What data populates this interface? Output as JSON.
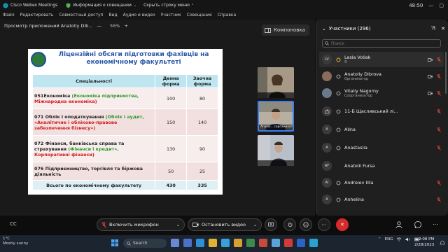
{
  "window": {
    "app_title": "Cisco Webex Meetings",
    "meeting_info": "Информация о совещании",
    "hide_menu": "Скрыть строку меню",
    "timer": "48:50"
  },
  "menu": [
    "Файл",
    "Редактировать",
    "Совместный доступ",
    "Вид",
    "Аудио и видео",
    "Участник",
    "Совещание",
    "Справка"
  ],
  "share": {
    "label": "Просмотр приложений Anatoliy Dib...",
    "minus": "—",
    "zoom": "56%",
    "plus": "+"
  },
  "layout_button": "Компоновка",
  "slide": {
    "title": "Ліцензійні обсяги підготовки фахівців на економічному факультеті",
    "headers": [
      "Спеціальності",
      "Денна форма",
      "Заочна форма"
    ],
    "rows": [
      {
        "name_prefix": "051Економіка ",
        "name_green": "(Економіка підприємства, ",
        "name_red": "Міжнародна економіка)",
        "day": "100",
        "extra": "80"
      },
      {
        "name_prefix": "071 Облік і оподаткування ",
        "name_green": "(Облік і аудит, ",
        "name_red": "«Аналітичне і обліково-правове забезпечення бізнесу»)",
        "day": "150",
        "extra": "140"
      },
      {
        "name_prefix": "072 Фінанси, банківська справа та страхування ",
        "name_green": "(Фінанси і кредит», ",
        "name_red": "Корпоративні фінанси)",
        "day": "130",
        "extra": "90"
      },
      {
        "name_prefix": "076 Підприємництво, торгівля та біржова діяльність",
        "name_green": "",
        "name_red": "",
        "day": "50",
        "extra": "25"
      }
    ],
    "total": {
      "label": "Всього по економічному факультету",
      "day": "430",
      "extra": "335"
    }
  },
  "tiles": [
    {
      "caption": ""
    },
    {
      "caption": "Anatol... (организатор)"
    },
    {
      "caption": ""
    }
  ],
  "panel": {
    "title": "Участники (296)",
    "search_placeholder": "Поиск",
    "participants": [
      {
        "initials": "LV",
        "name": "Lesia Voliak",
        "role": "Я"
      },
      {
        "initials": "",
        "name": "Anatoliy Dibrova",
        "role": "Организатор"
      },
      {
        "initials": "",
        "name": "Vitaliy Nagorny",
        "role": "Соорганизатор"
      },
      {
        "initials": "",
        "name": "11-Б Щасливський лі...",
        "role": ""
      },
      {
        "initials": "A",
        "name": "Alina",
        "role": ""
      },
      {
        "initials": "A",
        "name": "Anastasiia",
        "role": ""
      },
      {
        "initials": "AF",
        "name": "Anatolii Fursa",
        "role": ""
      },
      {
        "initials": "AI",
        "name": "Andreiev Illia",
        "role": ""
      },
      {
        "initials": "A",
        "name": "Anhelina",
        "role": ""
      }
    ]
  },
  "controls": {
    "mic": "Включить микрофон",
    "video": "Остановить видео"
  },
  "taskbar": {
    "temp": "1°C",
    "weather": "Mostly sunny",
    "search": "Search",
    "lang": "ENG",
    "time": "2:08 PM",
    "date": "2/28/2023"
  }
}
